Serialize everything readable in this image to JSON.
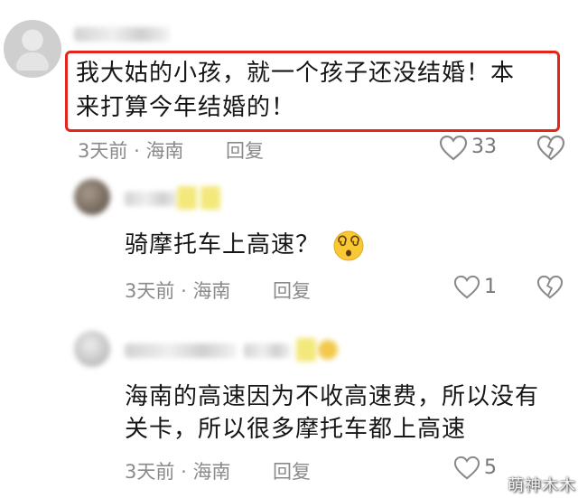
{
  "comment1": {
    "text_line1": "我大姑的小孩，就一个孩子还没结婚！本",
    "text_line2": "来打算今年结婚的！",
    "time": "3天前",
    "dot": "·",
    "location": "海南",
    "reply_label": "回复",
    "likes": "33"
  },
  "reply1": {
    "text": "骑摩托车上高速？",
    "emoji": "dizzy-face",
    "time": "3天前",
    "dot": "·",
    "location": "海南",
    "reply_label": "回复",
    "likes": "1"
  },
  "reply2": {
    "text_line1": "海南的高速因为不收高速费，所以没有",
    "text_line2": "关卡，所以很多摩托车都上高速",
    "time": "3天前",
    "dot": "·",
    "location": "海南",
    "reply_label": "回复",
    "likes": "5"
  },
  "watermark": "萌神木木",
  "colors": {
    "highlight": "#e2261c",
    "meta": "#8a8a8a"
  }
}
